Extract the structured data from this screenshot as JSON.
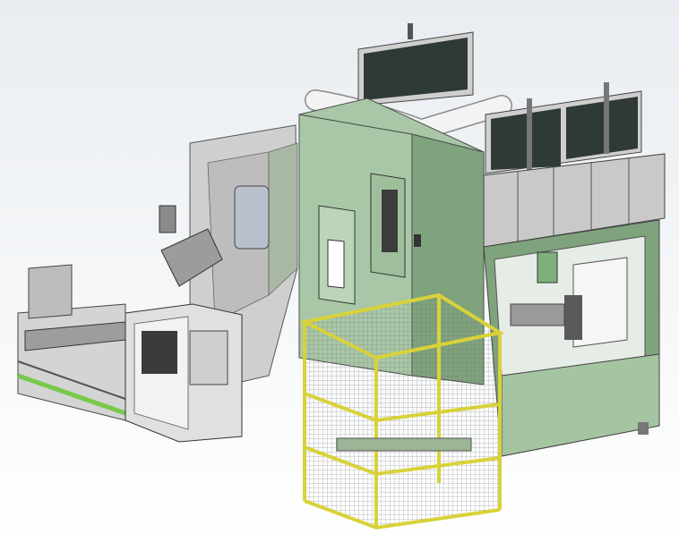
{
  "scene": {
    "subject": "industrial-machine-cad-render",
    "colors": {
      "background_top": "#e9edf1",
      "background_bottom": "#ffffff",
      "machine_green": "#a9c7a6",
      "machine_green_dark": "#7fa37c",
      "panel_grey": "#c9c9c9",
      "panel_grey_dark": "#8f8f8f",
      "guard_yellow": "#d8d23a",
      "monitor_dark": "#2f3a36",
      "duct_white": "#f3f3f3",
      "conveyor_green": "#78c84a"
    }
  }
}
